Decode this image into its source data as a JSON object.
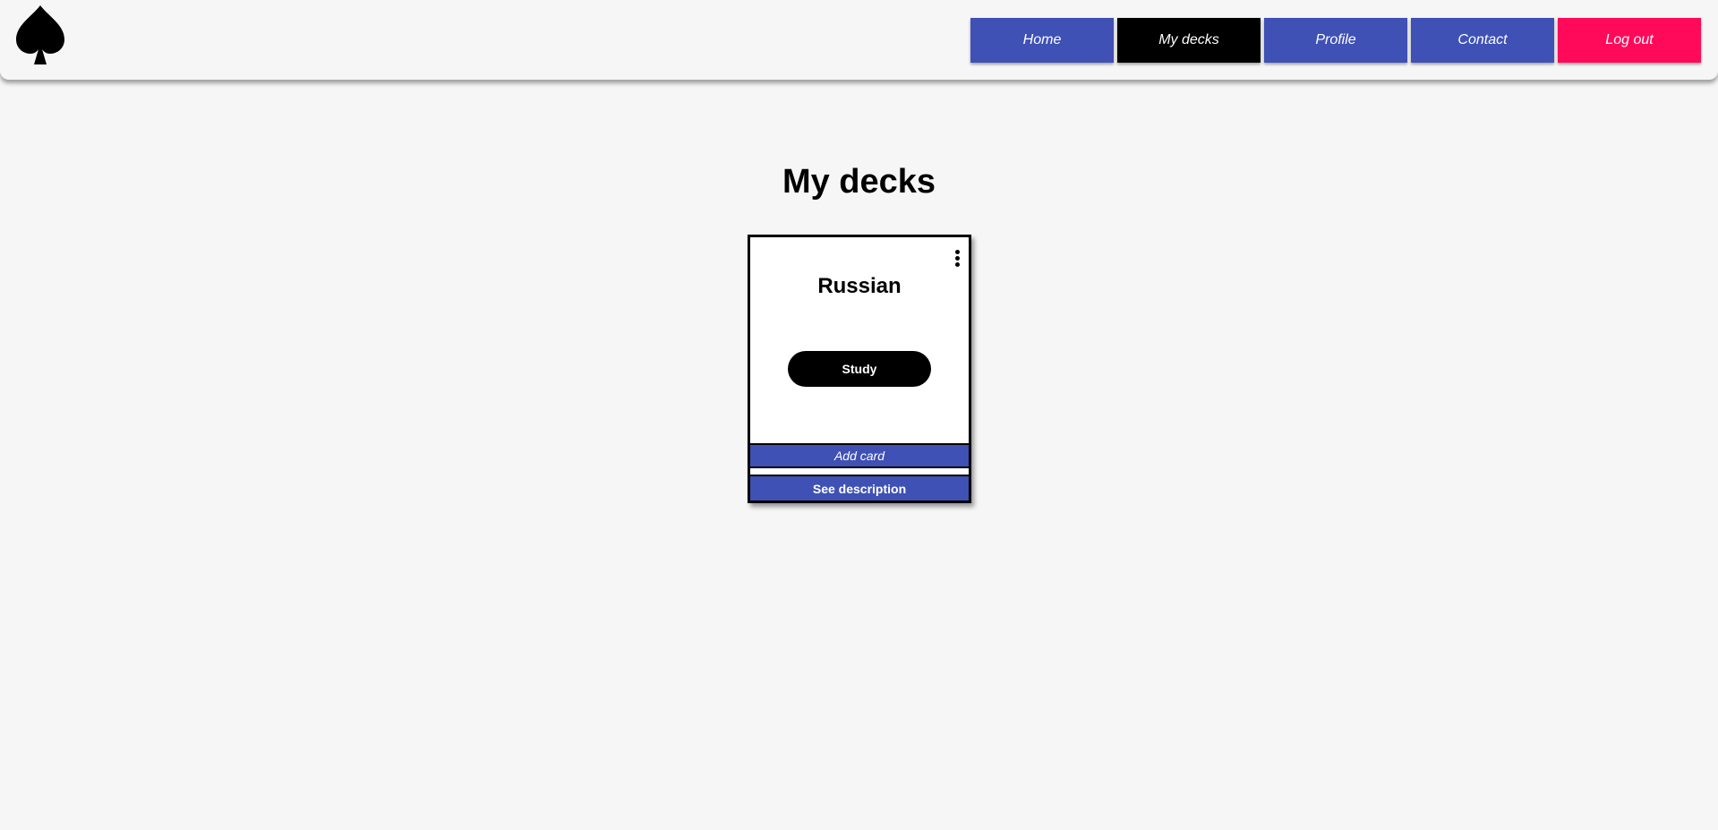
{
  "header": {
    "logo_icon": "spade-icon",
    "nav": [
      {
        "label": "Home"
      },
      {
        "label": "My decks"
      },
      {
        "label": "Profile"
      },
      {
        "label": "Contact"
      },
      {
        "label": "Log out"
      }
    ],
    "colors": {
      "nav_blue": "#3f51b5",
      "nav_active": "#000000",
      "logout": "#ff0a5a"
    }
  },
  "main": {
    "title": "My decks",
    "decks": [
      {
        "name": "Russian",
        "menu_icon": "more-vertical-icon",
        "study_label": "Study",
        "add_card_label": "Add card",
        "see_description_label": "See description"
      }
    ]
  }
}
